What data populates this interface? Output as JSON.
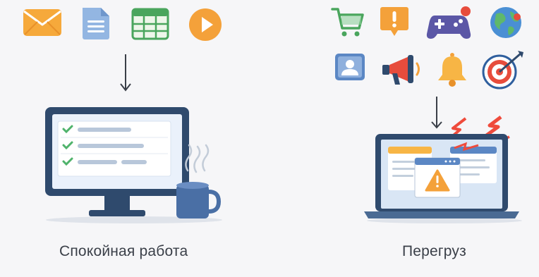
{
  "left_panel": {
    "caption": "Спокойная работа",
    "icons": [
      "envelope-icon",
      "document-icon",
      "spreadsheet-icon",
      "play-icon"
    ],
    "checklist_items": 3,
    "accent_color": "#2f4a6d",
    "check_color": "#4fb36b"
  },
  "right_panel": {
    "caption": "Перегруз",
    "icons": [
      "shopping-cart-icon",
      "alert-bubble-icon",
      "gamepad-icon",
      "globe-icon",
      "user-card-icon",
      "megaphone-icon",
      "bell-icon",
      "target-icon"
    ],
    "alert_color": "#f3a23a",
    "lightning_color": "#ef4b3c"
  }
}
